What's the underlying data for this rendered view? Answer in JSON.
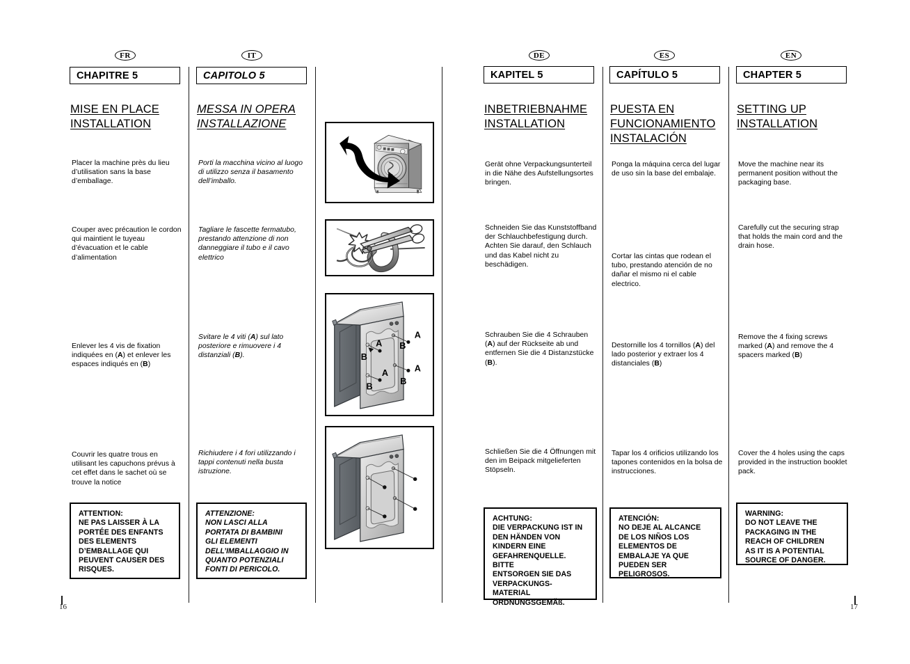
{
  "document": {
    "type": "appliance-instruction-manual-spread",
    "left_page_number": "16",
    "right_page_number": "17"
  },
  "columns": [
    {
      "lang_badge": "FR",
      "chapter_label": "CHAPITRE 5",
      "heading_line1": "MISE EN PLACE",
      "heading_line2": "INSTALLATION",
      "italic": false,
      "paragraphs": [
        "Placer la machine près du lieu d’utilisation sans la base d’emballage.",
        "Couper avec précaution le cordon qui maintient le tuyeau d’évacuation et le cable d’alimentation",
        "Enlever les 4 vis de fixation indiquées en (A) et enlever les espaces indiqués en (B)",
        "Couvrir les quatre trous en utilisant les capuchons prévus à cet effet dans le sachet où se trouve la notice"
      ],
      "warning": "ATTENTION:\nNE PAS LAISSER À LA\nPORTÉE DES ENFANTS\nDES ELEMENTS\nD’EMBALLAGE QUI\nPEUVENT CAUSER DES\nRISQUES."
    },
    {
      "lang_badge": "IT",
      "chapter_label": "CAPITOLO 5",
      "heading_line1": "MESSA IN OPERA",
      "heading_line2": "INSTALLAZIONE",
      "italic": true,
      "paragraphs": [
        "Porti la macchina vicino al luogo di utilizzo senza il basamento dell’imballo.",
        "Tagliare le fascette fermatubo, prestando attenzione di non danneggiare il tubo e il cavo elettrico",
        "Svitare le 4 viti (A) sul lato posteriore e rimuovere i 4 distanziali (B).",
        "Richiudere i 4 fori utilizzando i tappi contenuti nella busta istruzione."
      ],
      "warning": "ATTENZIONE:\nNON LASCI ALLA\nPORTATA DI BAMBINI\nGLI ELEMENTI\nDELL’IMBALLAGGIO IN\nQUANTO POTENZIALI\nFONTI DI PERICOLO."
    },
    {
      "lang_badge": "DE",
      "chapter_label": "KAPITEL 5",
      "heading_line1": "INBETRIEBNAHME",
      "heading_line2": "INSTALLATION",
      "italic": false,
      "paragraphs": [
        "Gerät ohne Verpackungsunterteil in die Nähe des Aufstellungsortes bringen.",
        "Schneiden Sie das Kunststoffband der Schlauchbefestigung durch. Achten Sie darauf, den Schlauch und das Kabel nicht zu beschädigen.",
        "Schrauben Sie die 4 Schrauben (A) auf der Rückseite ab und entfernen Sie die 4 Distanzstücke (B).",
        "Schließen Sie die 4 Öffnungen mit den im Beipack mitgelieferten Stöpseln."
      ],
      "warning": "ACHTUNG:\nDIE VERPACKUNG IST IN\nDEN HÄNDEN VON\nKINDERN EINE\nGEFAHRENQUELLE. BITTE\nENTSORGEN SIE DAS\nVERPACKUNGS-\nMATERIAL\nORDNUNGSGEMÄß."
    },
    {
      "lang_badge": "ES",
      "chapter_label": "CAPÍTULO 5",
      "heading_line1": "PUESTA EN",
      "heading_line1b": "FUNCIONAMIENTO",
      "heading_line2": "INSTALACIÓN",
      "italic": false,
      "paragraphs": [
        "Ponga la máquina cerca del lugar de uso sin la base del embalaje.",
        "Cortar las cintas que rodean el tubo, prestando atención de no dañar el mismo ni el cable electrico.",
        "Destornille los 4 tornillos (A) del lado posterior y extraer los 4 distanciales (B)",
        "Tapar los 4 orificios utilizando los tapones contenidos en la bolsa de instrucciones."
      ],
      "warning": "ATENCIÓN:\nNO DEJE AL ALCANCE\nDE LOS NIÑOS LOS\nELEMENTOS DE\nEMBALAJE YA QUE\nPUEDEN SER\nPELIGROSOS."
    },
    {
      "lang_badge": "EN",
      "chapter_label": "CHAPTER 5",
      "heading_line1": "SETTING UP",
      "heading_line2": "INSTALLATION",
      "italic": false,
      "paragraphs": [
        "Move the machine near its permanent position without the packaging base.",
        "Carefully cut the securing strap that holds the main cord and the drain hose.",
        "Remove the 4 fixing screws marked (A) and remove the 4 spacers marked (B)",
        "Cover the 4 holes using the caps provided in the instruction booklet pack."
      ],
      "warning": "WARNING:\nDO NOT LEAVE THE\nPACKAGING IN THE\nREACH OF CHILDREN\nAS IT IS A POTENTIAL\nSOURCE OF DANGER."
    }
  ],
  "figures": [
    {
      "name": "washing-machine-lift-off-base",
      "caption_labels": []
    },
    {
      "name": "scissors-cutting-hose-strap",
      "caption_labels": []
    },
    {
      "name": "machine-rear-transit-bolts",
      "caption_labels": [
        "A",
        "B",
        "A",
        "B",
        "A",
        "B",
        "A",
        "B"
      ]
    },
    {
      "name": "machine-rear-holes-capped",
      "caption_labels": []
    }
  ],
  "colors": {
    "ink": "#000000",
    "paper": "#ffffff",
    "body_text": "#4a4a4a",
    "machine_light": "#d9d9d9",
    "machine_dark": "#6b6f74"
  }
}
